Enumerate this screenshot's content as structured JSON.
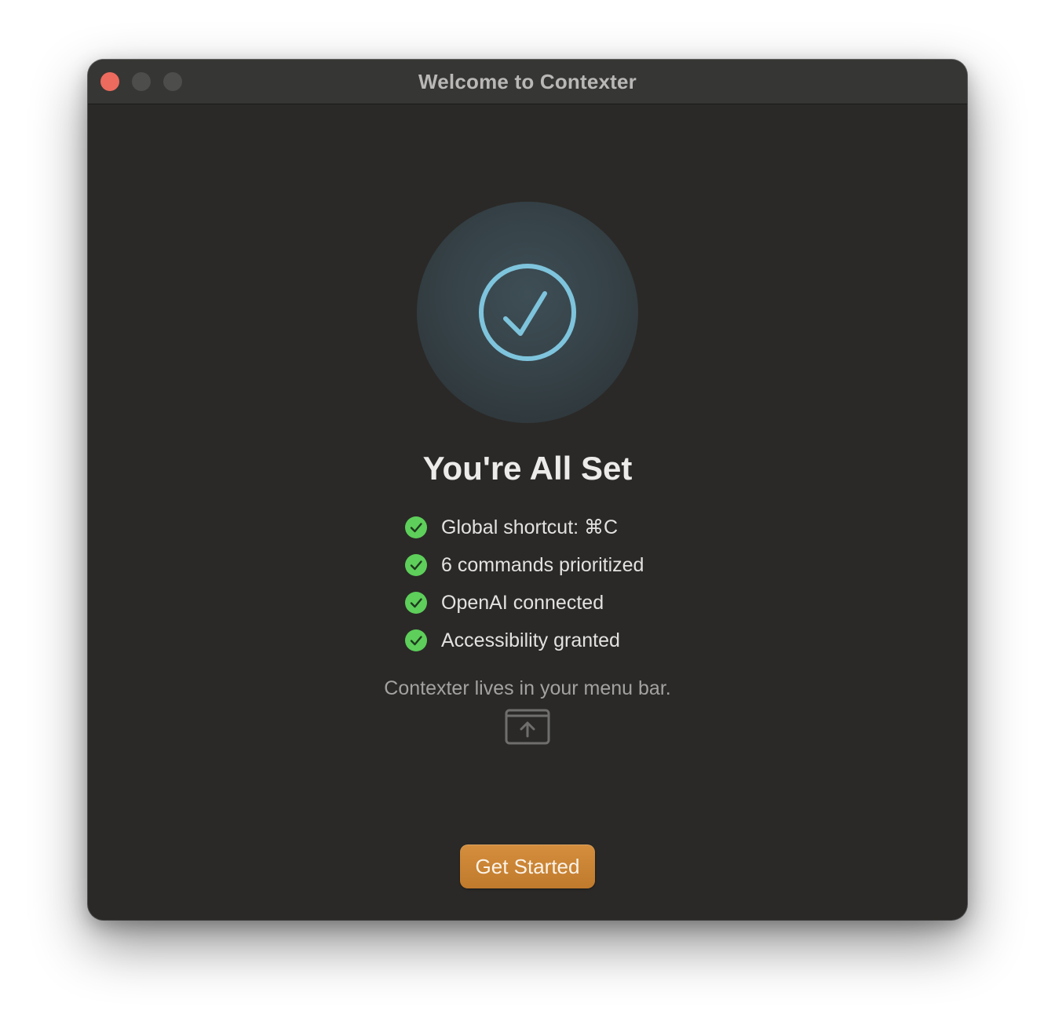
{
  "window": {
    "title": "Welcome to Contexter"
  },
  "main": {
    "headline": "You're All Set",
    "status_icon": "checkmark-circle-icon",
    "checklist": [
      {
        "label": "Global shortcut: ⌘C",
        "icon": "green-checkmark-icon",
        "done": true
      },
      {
        "label": "6 commands prioritized",
        "icon": "green-checkmark-icon",
        "done": true
      },
      {
        "label": "OpenAI connected",
        "icon": "green-checkmark-icon",
        "done": true
      },
      {
        "label": "Accessibility granted",
        "icon": "green-checkmark-icon",
        "done": true
      }
    ],
    "menu_bar_hint": "Contexter lives in your menu bar.",
    "menu_bar_icon": "menu-bar-upload-icon",
    "get_started_label": "Get Started"
  },
  "colors": {
    "accent_button": "#c98533",
    "check_green": "#5dcf5a",
    "status_ring": "#7ec4dc"
  }
}
